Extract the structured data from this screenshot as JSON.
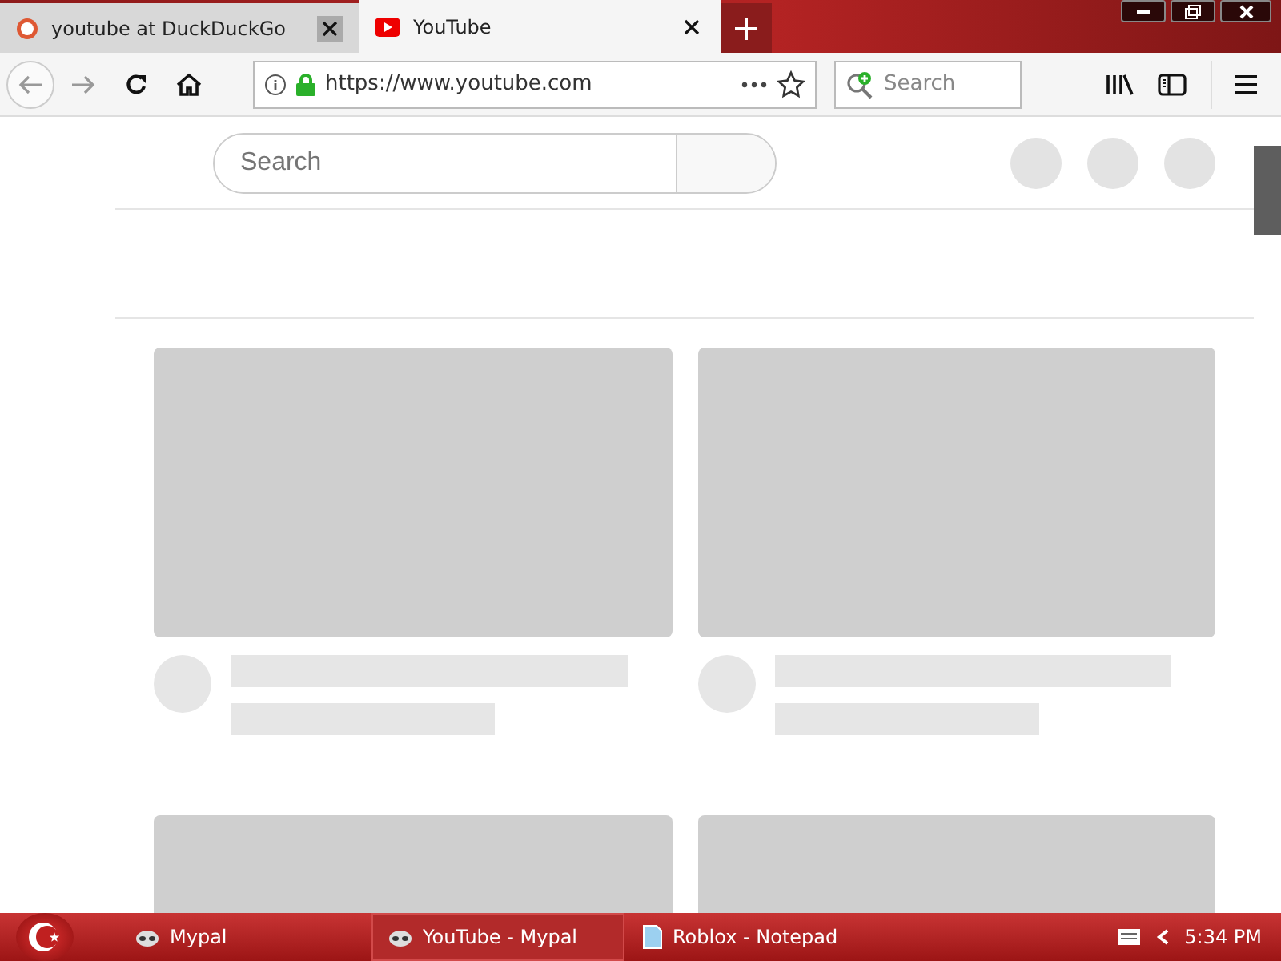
{
  "tabs": [
    {
      "title": "youtube at DuckDuckGo",
      "selected": false
    },
    {
      "title": "YouTube",
      "selected": true
    }
  ],
  "toolbar": {
    "url": "https://www.youtube.com",
    "search_placeholder": "Search"
  },
  "page": {
    "search_placeholder": "Search"
  },
  "taskbar": {
    "items": [
      {
        "label": "Mypal",
        "kind": "browser",
        "selected": false
      },
      {
        "label": "YouTube - Mypal",
        "kind": "browser",
        "selected": true
      },
      {
        "label": "Roblox - Notepad",
        "kind": "notepad",
        "selected": false
      }
    ],
    "time": "5:34 PM"
  }
}
